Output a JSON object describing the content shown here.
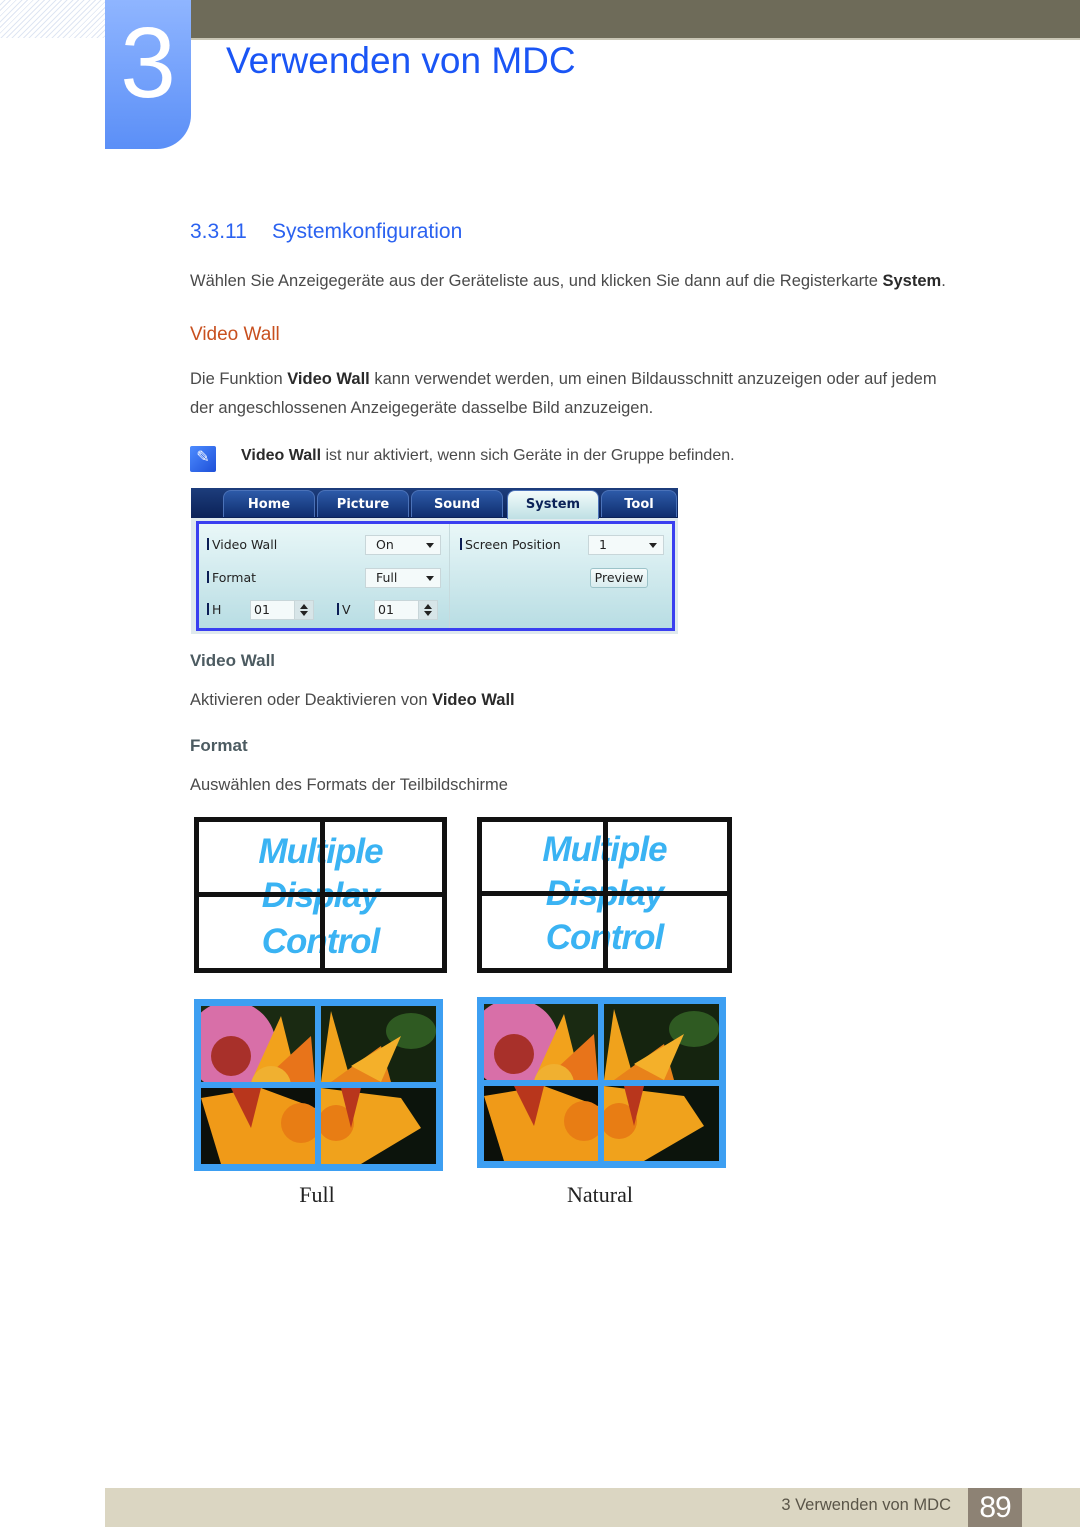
{
  "header": {
    "chapter_number": "3",
    "chapter_title": "Verwenden von MDC"
  },
  "section": {
    "number": "3.3.11",
    "title": "Systemkonfiguration",
    "intro_text": "Wählen Sie Anzeigegeräte aus der Geräteliste aus, und klicken Sie dann auf die Registerkarte ",
    "intro_bold": "System",
    "intro_end": "."
  },
  "video_wall": {
    "heading": "Video Wall",
    "desc_pre": "Die Funktion ",
    "desc_bold": "Video Wall",
    "desc_line1_rest": " kann verwendet werden, um einen Bildausschnitt anzuzeigen oder auf jedem",
    "desc_line2": "der angeschlossenen Anzeigegeräte dasselbe Bild anzuzeigen.",
    "note_bold": "Video Wall",
    "note_rest": " ist nur aktiviert, wenn sich Geräte in der Gruppe befinden.",
    "note_icon": "note-pencil-icon"
  },
  "mdc_ui": {
    "tabs": [
      {
        "label": "Home",
        "active": false
      },
      {
        "label": "Picture",
        "active": false
      },
      {
        "label": "Sound",
        "active": false
      },
      {
        "label": "System",
        "active": true
      },
      {
        "label": "Tool",
        "active": false
      }
    ],
    "fields": {
      "video_wall_label": "Video Wall",
      "video_wall_value": "On",
      "format_label": "Format",
      "format_value": "Full",
      "h_label": "H",
      "h_value": "01",
      "v_label": "V",
      "v_value": "01",
      "screen_position_label": "Screen Position",
      "screen_position_value": "1",
      "preview_label": "Preview"
    }
  },
  "options": {
    "video_wall_heading": "Video Wall",
    "video_wall_desc_pre": "Aktivieren oder Deaktivieren von ",
    "video_wall_desc_bold": "Video Wall",
    "format_heading": "Format",
    "format_desc": "Auswählen des Formats der Teilbildschirme"
  },
  "illustrations": {
    "mdc_words": [
      "Multiple",
      "Display",
      "Control"
    ],
    "captions": [
      "Full",
      "Natural"
    ],
    "accent_color": "#3d9ff2"
  },
  "footer": {
    "text": "3 Verwenden von MDC",
    "page": "89"
  }
}
